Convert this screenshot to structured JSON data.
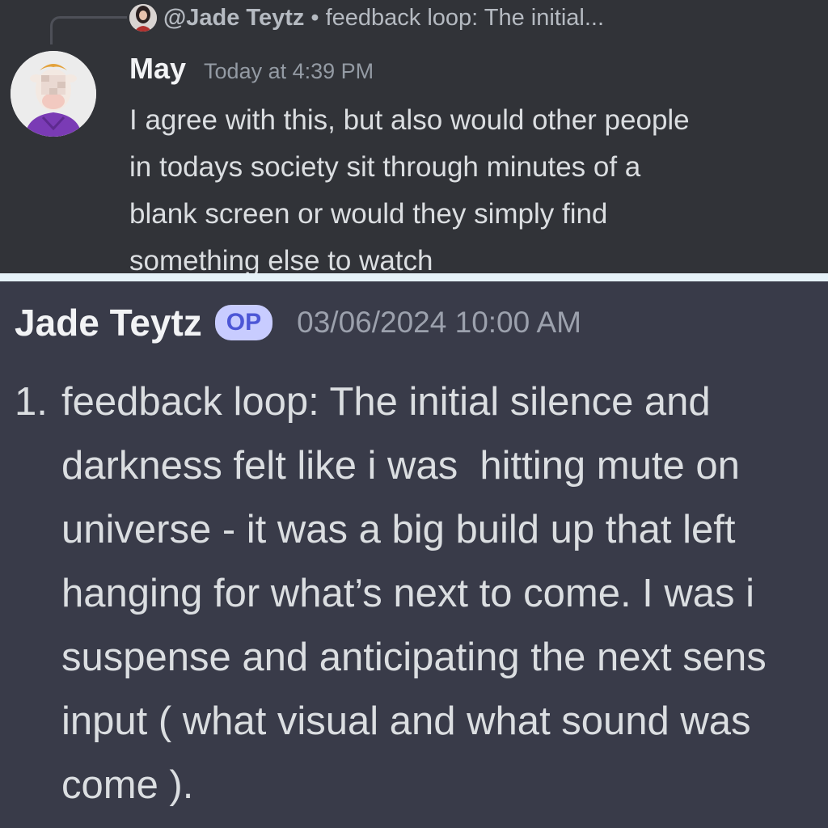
{
  "top_message": {
    "reply": {
      "username": "@Jade Teytz",
      "separator": "•",
      "preview": "feedback loop: The initial..."
    },
    "author": "May",
    "timestamp": "Today at 4:39 PM",
    "lines": [
      "I agree with this, but also would other people",
      "in todays society sit through minutes of a",
      "blank screen or would they simply find",
      "something else to watch"
    ]
  },
  "bottom_message": {
    "author": "Jade Teytz",
    "badge": "OP",
    "timestamp": "03/06/2024 10:00 AM",
    "list_number": "1.",
    "lines": [
      "feedback loop: The initial silence and",
      "darkness felt like i was  hitting mute on",
      "universe - it was a big build up that left",
      "hanging for what’s next to come. I was i",
      "suspense and anticipating the next sens",
      "input ( what visual and what sound was",
      "come )."
    ]
  },
  "colors": {
    "top_background": "#313338",
    "bottom_background": "#393b49",
    "divider": "#e6f2f8",
    "badge_background": "#c8ccff",
    "badge_text": "#4c56d6"
  },
  "icons": {
    "reply_avatar": "user-photo-avatar",
    "author_avatar": "cartoon-cow-avatar"
  }
}
